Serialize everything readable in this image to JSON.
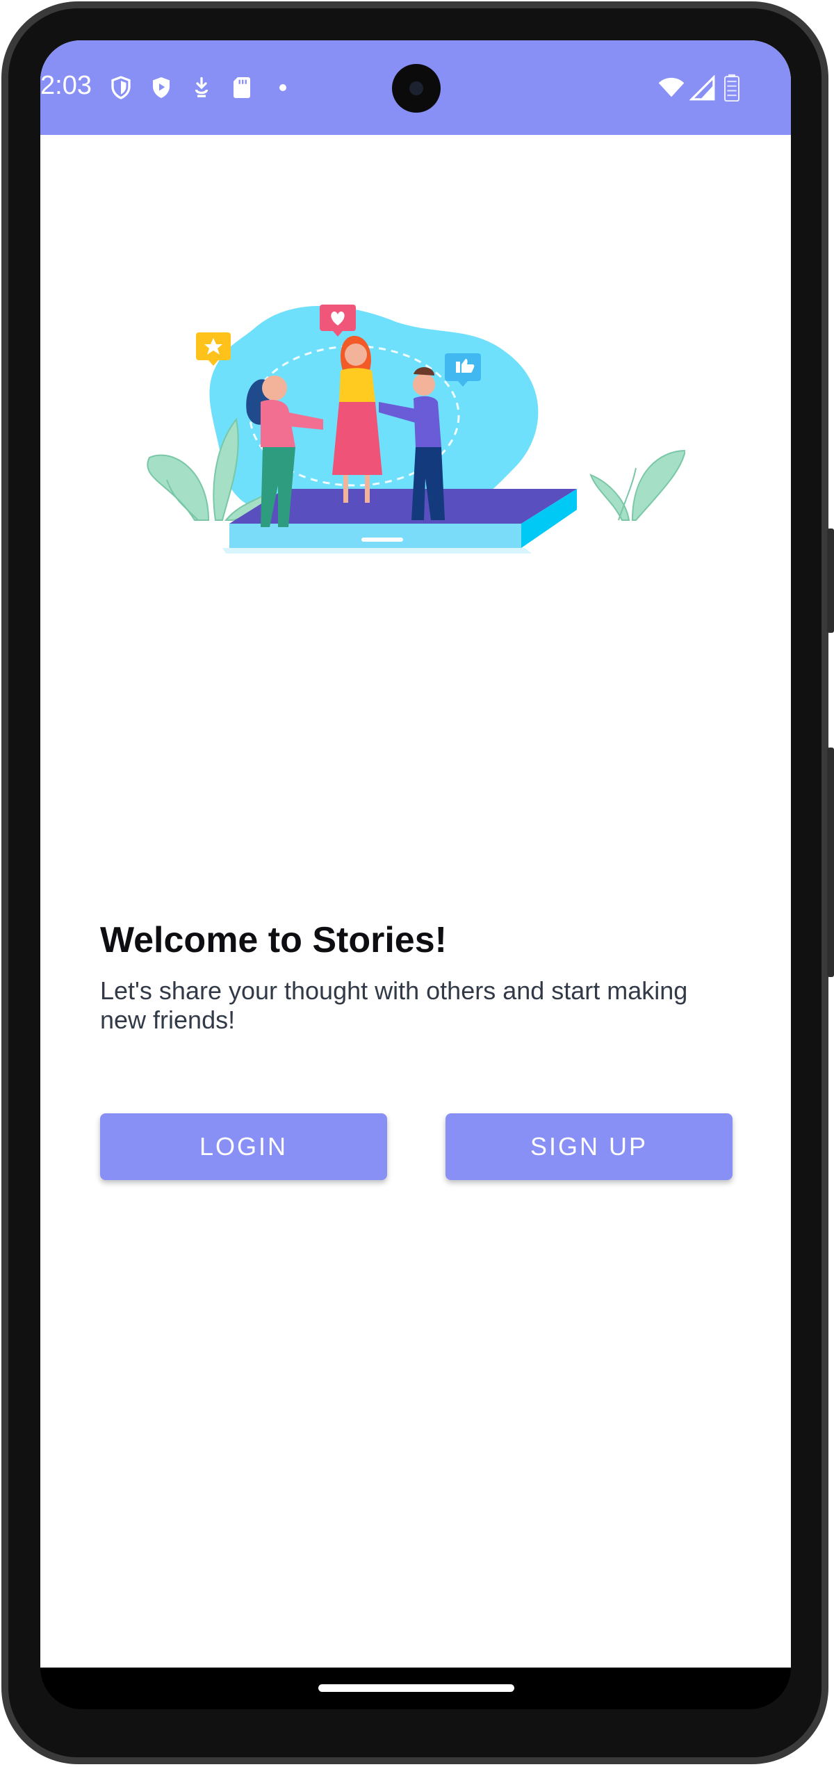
{
  "status_bar": {
    "time": "2:03",
    "left_icons": [
      "shield-icon",
      "play-protect-icon",
      "download-icon",
      "sd-card-icon",
      "notification-dot-icon"
    ],
    "right_icons": [
      "wifi-icon",
      "signal-icon",
      "battery-icon"
    ],
    "background_color": "#8890f5"
  },
  "illustration": {
    "icon": "people-sharing-illustration"
  },
  "welcome": {
    "title": "Welcome to Stories!",
    "subtitle": "Let's share your thought with others and start making new friends!"
  },
  "actions": {
    "login_label": "LOGIN",
    "signup_label": "SIGN UP",
    "button_color": "#8890f5"
  }
}
